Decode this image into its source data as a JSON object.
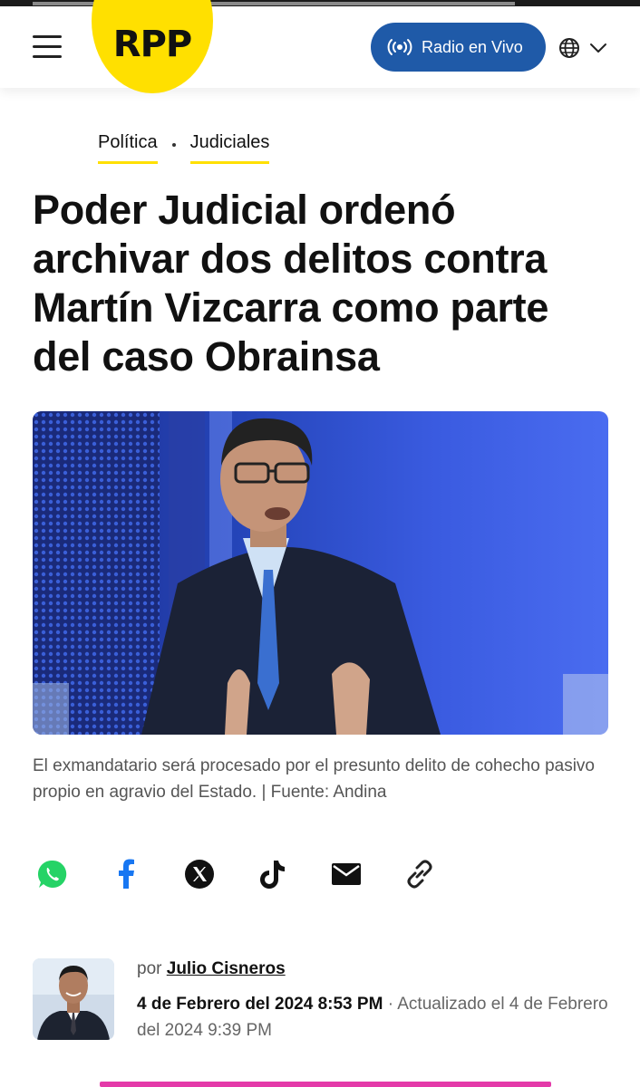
{
  "header": {
    "logo_text": "RPP",
    "radio_button_label": "Radio en Vivo",
    "brand_yellow": "#ffe000",
    "brand_blue": "#1f5aa8"
  },
  "breadcrumbs": [
    {
      "label": "Política"
    },
    {
      "label": "Judiciales"
    }
  ],
  "article": {
    "headline": "Poder Judicial ordenó archivar dos delitos contra Martín Vizcarra como parte del caso Obrainsa",
    "image_caption": "El exmandatario será procesado por el presunto delito de cohecho pasivo propio en agravio del Estado. | Fuente: Andina"
  },
  "share": {
    "icons": [
      "whatsapp-icon",
      "facebook-icon",
      "x-icon",
      "tiktok-icon",
      "email-icon",
      "link-icon"
    ]
  },
  "author": {
    "by_prefix": "por",
    "name": "Julio Cisneros",
    "published": "4 de Febrero del 2024 8:53 PM",
    "separator": "·",
    "updated": "Actualizado el 4 de Febrero del 2024 9:39 PM"
  }
}
